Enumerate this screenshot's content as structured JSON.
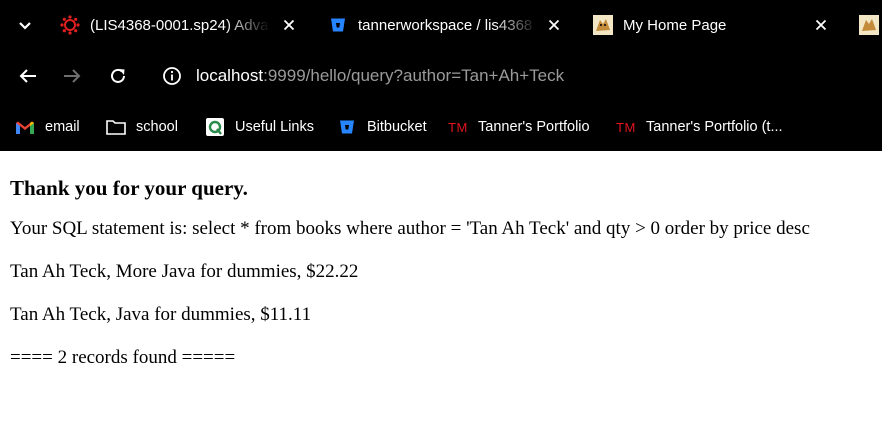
{
  "browser": {
    "tabs": [
      {
        "title": "(LIS4368-0001.sp24) Advan",
        "favicon": "canvas-lms-icon",
        "favicon_color": "#e0201f"
      },
      {
        "title": "tannerworkspace / lis4368 ,",
        "favicon": "bitbucket-icon",
        "favicon_color": "#2684ff"
      },
      {
        "title": "My Home Page",
        "favicon": "tomcat-icon"
      }
    ],
    "address": {
      "host": "localhost",
      "rest": ":9999/hello/query?author=Tan+Ah+Teck"
    },
    "bookmarks": [
      {
        "label": "email",
        "icon": "gmail-icon"
      },
      {
        "label": "school",
        "icon": "folder-icon"
      },
      {
        "label": "Useful Links",
        "icon": "qualys-icon"
      },
      {
        "label": "Bitbucket",
        "icon": "bitbucket-icon"
      },
      {
        "label": "Tanner's Portfolio",
        "icon": "tm-logo-icon",
        "icon_text": "TM"
      },
      {
        "label": "Tanner's Portfolio (t...",
        "icon": "tm-logo-icon",
        "icon_text": "TM"
      }
    ]
  },
  "page": {
    "heading": "Thank you for your query.",
    "sql_line": "Your SQL statement is: select * from books where author = 'Tan Ah Teck' and qty > 0 order by price desc",
    "rows": [
      "Tan Ah Teck, More Java for dummies, $22.22",
      "Tan Ah Teck, Java for dummies, $11.11"
    ],
    "footer": "==== 2 records found ====="
  },
  "colors": {
    "chrome_bg": "#000000",
    "accent_red": "#e0151c",
    "bitbucket_blue": "#2684ff"
  }
}
